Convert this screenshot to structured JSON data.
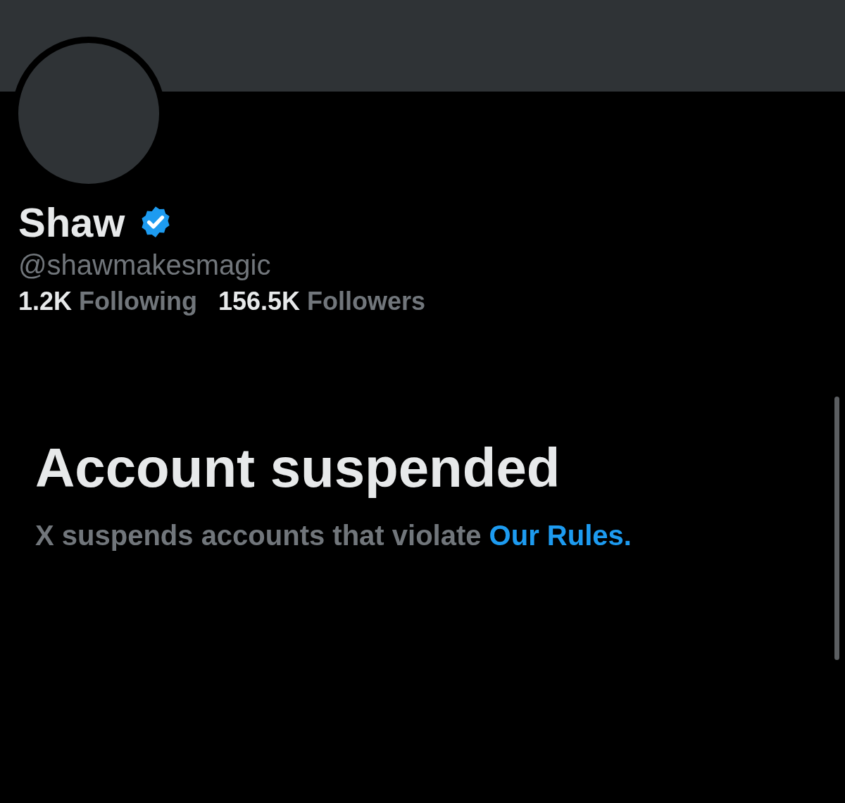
{
  "profile": {
    "name": "Shaw",
    "verified": true,
    "handle": "@shawmakesmagic",
    "stats": [
      {
        "count": "1.2K",
        "label": "Following"
      },
      {
        "count": "156.5K",
        "label": "Followers"
      }
    ]
  },
  "notice": {
    "title": "Account suspended",
    "text": "X suspends accounts that violate ",
    "link": "Our Rules."
  }
}
